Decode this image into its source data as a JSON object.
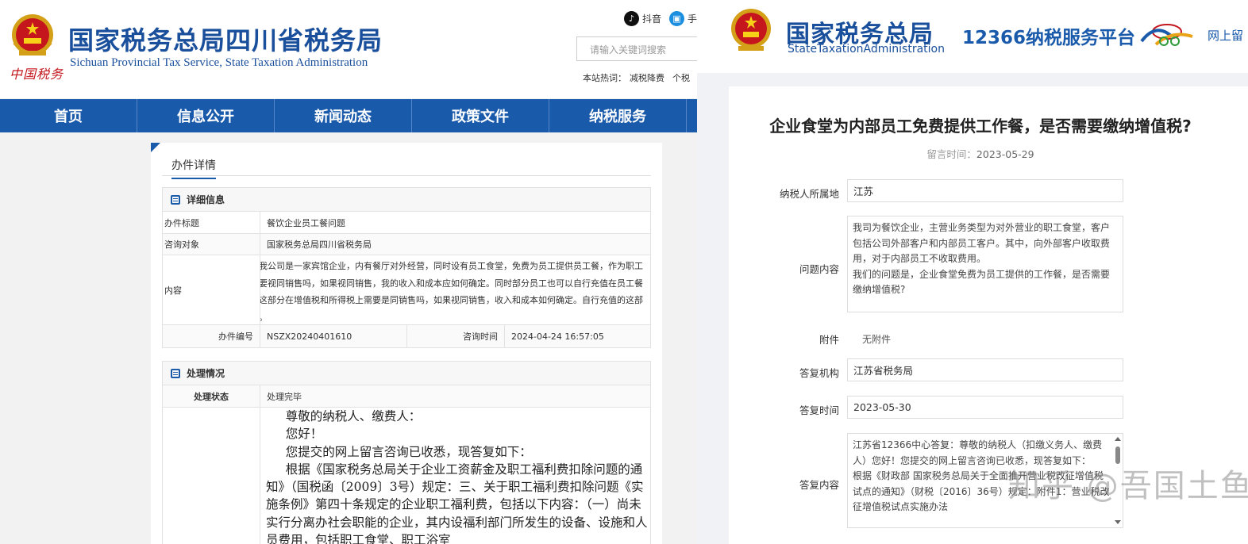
{
  "left": {
    "emblem_caption": "中国税务",
    "org_cn": "国家税务总局四川省税务局",
    "org_en": "Sichuan Provincial Tax Service, State Taxation Administration",
    "top_links": [
      {
        "icon": "tiktok-icon",
        "label": "抖音"
      },
      {
        "icon": "weibo-icon",
        "label": "手"
      }
    ],
    "search_placeholder": "请输入关键词搜索",
    "hotwords_label": "本站热词：",
    "hotwords": [
      "减税降费",
      "个税"
    ],
    "nav": [
      "首页",
      "信息公开",
      "新闻动态",
      "政策文件",
      "纳税服务"
    ],
    "card_title": "办件详情",
    "detail": {
      "heading": "详细信息",
      "subject_label": "办件标题",
      "subject": "餐饮企业员工餐问题",
      "target_label": "咨询对象",
      "target": "国家税务总局四川省税务局",
      "content_label": "内容",
      "content": "您好，我公司是一家宾馆企业，内有餐厅对外经营，同时设有员工食堂，免费为员工提供员工餐，作为职工福利，在企业所得税上需要视同销售吗，如果视同销售，我的收入和成本应如何确定。同时部分员工也可以自行充值在员工餐厅消费，员工自行充值的这部分在增值税和所得税上需要是同销售吗，如果视同销售，收入和成本如何确定。自行充值的这部分在账务上应该如何处理。",
      "number_label": "办件编号",
      "number": "NSZX20240401610",
      "time_label": "咨询时间",
      "time": "2024-04-24 16:57:05"
    },
    "process": {
      "heading": "处理情况",
      "status_label": "处理状态",
      "status": "处理完毕",
      "reply_lines": [
        "尊敬的纳税人、缴费人：",
        "您好！",
        "您提交的网上留言咨询已收悉，现答复如下：",
        "根据《国家税务总局关于企业工资薪金及职工福利费扣除问题的通知》（国税函〔2009〕3号）规定：三、关于职工福利费扣除问题《实施条例》第四十条规定的企业职工福利费，包括以下内容：（一）尚未实行分离办社会职能的企业，其内设福利部门所发生的设备、设施和人员费用，包括职工食堂、职工浴室"
      ]
    }
  },
  "right": {
    "org_cn": "国家税务总局",
    "org_en": "StateTaxationAdministration",
    "platform": "12366纳税服务平台",
    "online_link": "网上留",
    "title": "企业食堂为内部员工免费提供工作餐，是否需要缴纳增值税?",
    "time_label": "留言时间：",
    "time": "2023-05-29",
    "fields": {
      "location_label": "纳税人所属地",
      "location": "江苏",
      "question_label": "问题内容",
      "question": "我司为餐饮企业，主营业务类型为对外营业的职工食堂，客户包括公司外部客户和内部员工客户。其中，向外部客户收取费用，对于内部员工不收取费用。\n我们的问题是，企业食堂免费为员工提供的工作餐，是否需要缴纳增值税?",
      "attachment_label": "附件",
      "attachment": "无附件",
      "agency_label": "答复机构",
      "agency": "江苏省税务局",
      "reply_time_label": "答复时间",
      "reply_time": "2023-05-30",
      "reply_label": "答复内容",
      "reply": "江苏省12366中心答复：尊敬的纳税人（扣缴义务人、缴费人）您好！您提交的网上留言咨询已收悉，现答复如下：\n根据《财政部 国家税务总局关于全面推开营业税改征增值税试点的通知》（财税〔2016〕36号）规定：附件1：营业税改征增值税试点实施办法"
    },
    "watermark": "知乎 @吾国土鱼"
  }
}
